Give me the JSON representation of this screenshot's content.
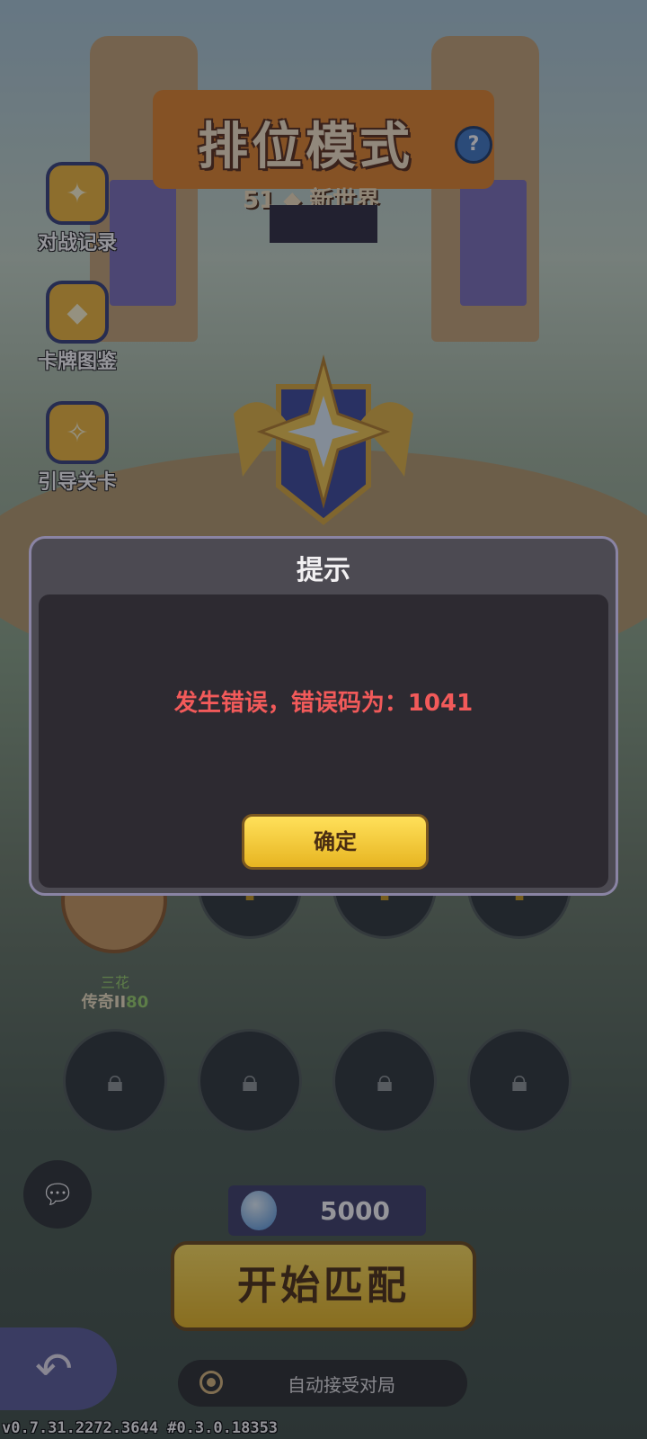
{
  "header": {
    "title": "排位模式",
    "help_icon": "?",
    "season": "51 ◆ 新世界"
  },
  "side_menu": [
    {
      "label": "对战记录",
      "icon": "battle-record-icon"
    },
    {
      "label": "卡牌图鉴",
      "icon": "card-collection-icon"
    },
    {
      "label": "引导关卡",
      "icon": "guide-level-icon"
    }
  ],
  "player": {
    "name": "三花",
    "rank_prefix": "传奇II",
    "rank_points": "80"
  },
  "gems": {
    "count": "5000"
  },
  "actions": {
    "start_match": "开始匹配",
    "auto_accept": "自动接受对局"
  },
  "version": "v0.7.31.2272.3644 #0.3.0.18353",
  "dialog": {
    "title": "提示",
    "message": "发生错误，错误码为：1041",
    "confirm": "确定"
  }
}
